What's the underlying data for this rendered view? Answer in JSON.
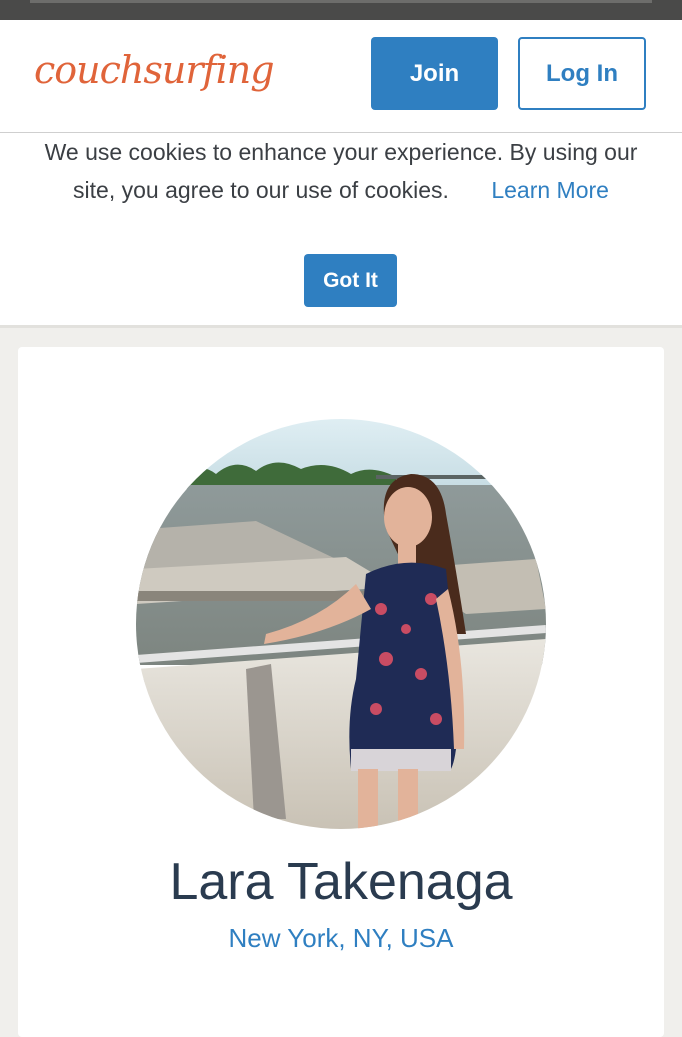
{
  "header": {
    "logo_text": "couchsurfing",
    "join_label": "Join",
    "login_label": "Log In"
  },
  "cookie_banner": {
    "message": "We use cookies to enhance your experience. By using our site, you agree to our use of cookies.",
    "learn_more": "Learn More",
    "got_it_label": "Got It"
  },
  "profile": {
    "name": "Lara Takenaga",
    "location": "New York, NY, USA"
  },
  "colors": {
    "brand_orange": "#e0643a",
    "accent_blue": "#2f7fc1",
    "name_text": "#2a3b4f",
    "page_bg": "#f0efec"
  }
}
